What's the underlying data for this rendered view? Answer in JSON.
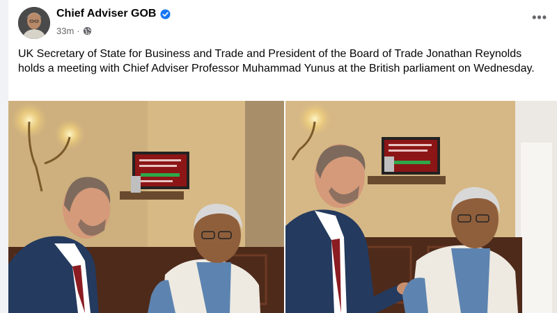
{
  "post": {
    "author": "Chief Adviser GOB",
    "timestamp": "33m",
    "separator": "·",
    "audience_icon": "globe-icon",
    "verified_icon": "verified-badge-icon",
    "more_icon": "more-options-icon",
    "more_label": "•••",
    "caption": "UK Secretary of State for Business and Trade and President of the Board of Trade Jonathan Reynolds holds a meeting with Chief Adviser Professor Muhammad Yunus at the British parliament on Wednesday."
  },
  "photos": [
    {
      "name": "meeting-photo-1"
    },
    {
      "name": "meeting-photo-2"
    }
  ],
  "colors": {
    "verified": "#1877f2",
    "text": "#050505",
    "meta": "#65676b",
    "wall": "#d9bd8a",
    "panel": "#5a2e1c"
  }
}
